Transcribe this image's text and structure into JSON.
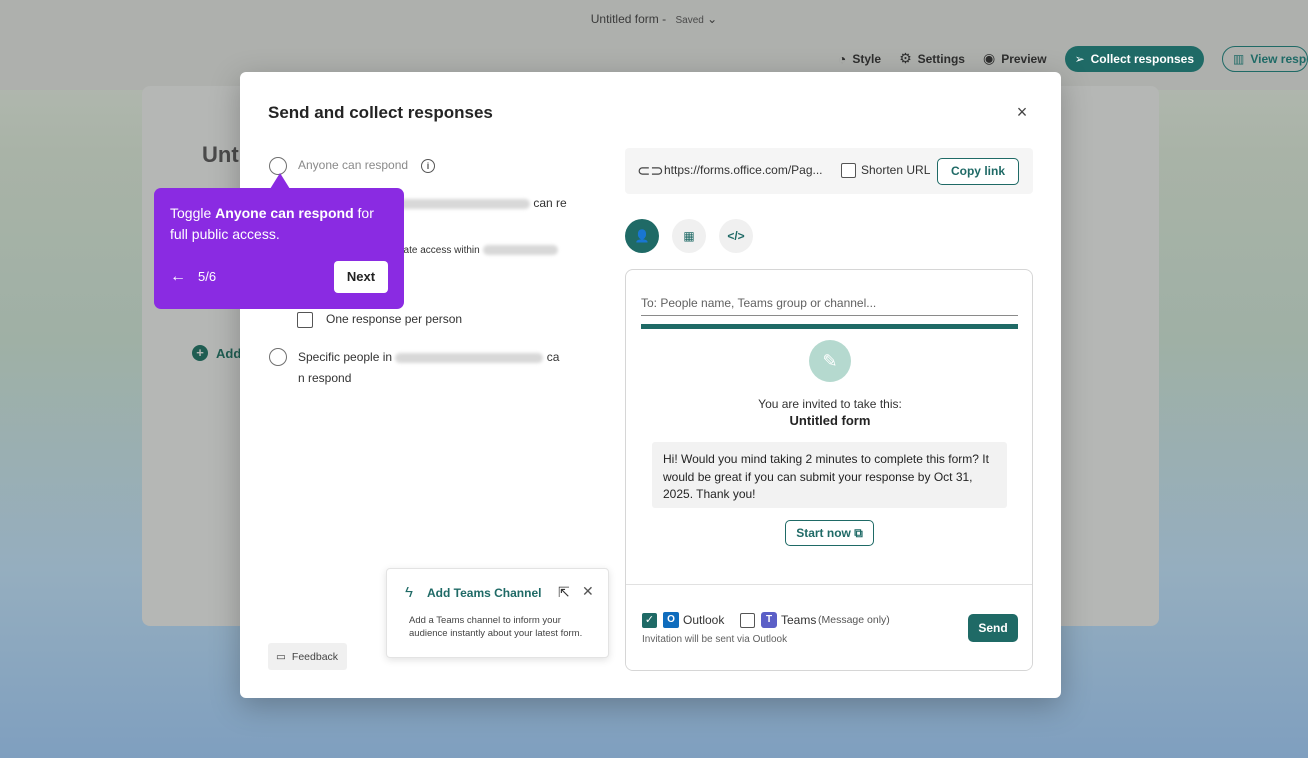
{
  "app": {
    "title": "Untitled form",
    "separator": "-",
    "status": "Saved",
    "toolbar": {
      "style": "Style",
      "settings": "Settings",
      "preview": "Preview",
      "collect": "Collect responses",
      "view": "View responses"
    },
    "bg_title": "Unt",
    "bg_add": "Add"
  },
  "dialog": {
    "title": "Send and collect responses",
    "close": "×",
    "options": {
      "anyone": "Anyone can respond",
      "org_suffix": "can re",
      "update_access": "date access within",
      "one_response": "One response per person",
      "specific_prefix": "Specific people in",
      "specific_suffix_1": "ca",
      "specific_suffix_2": "n respond"
    },
    "link": {
      "url": "https://forms.office.com/Pag...",
      "shorten_label": "Shorten URL",
      "copy_label": "Copy link"
    },
    "email": {
      "to_placeholder": "To: People name, Teams group or channel...",
      "invited_text": "You are invited to take this:",
      "form_name": "Untitled form",
      "message": "Hi! Would you mind taking 2 minutes to complete this form? It would be great if you can submit your response by Oct 31, 2025. Thank you!",
      "start_label": "Start now",
      "outlook_label": "Outlook",
      "teams_label": "Teams",
      "teams_note": "(Message only)",
      "send_note": "Invitation will be sent via Outlook",
      "send_label": "Send"
    },
    "teams_card": {
      "title": "Add Teams Channel",
      "description": "Add a Teams channel to inform your audience instantly about your latest form."
    },
    "feedback": "Feedback"
  },
  "tooltip": {
    "prefix": "Toggle ",
    "bold": "Anyone can respond",
    "suffix": " for full public access.",
    "counter": "5/6",
    "next": "Next"
  },
  "colors": {
    "accent": "#1f6a66",
    "tooltip": "#8a2be2"
  }
}
